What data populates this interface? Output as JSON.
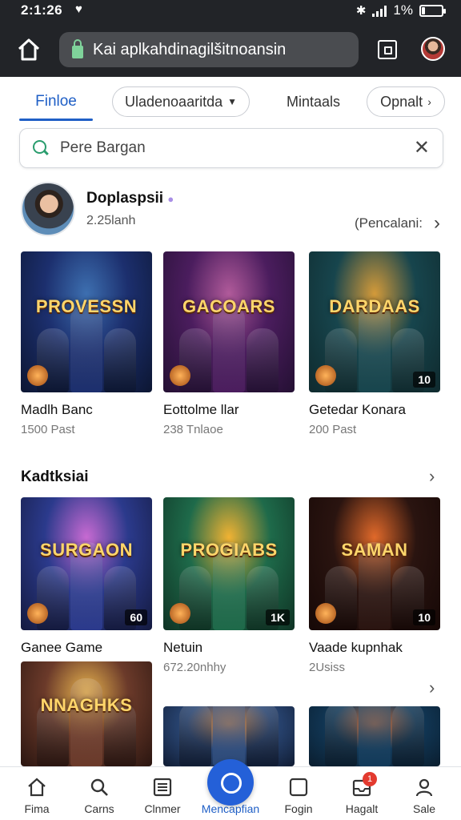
{
  "status": {
    "time": "2:1:26",
    "battery": "1%"
  },
  "browser": {
    "url": "Kai aplkahdinagilšitnoansin"
  },
  "filters": {
    "active_tab": "Finloe",
    "chip1": "Uladenoaaritda",
    "plain": "Mintaals",
    "chip2": "Opnalt"
  },
  "search": {
    "placeholder": "Pere Bargan",
    "value": ""
  },
  "profile": {
    "name": "Doplaspsii",
    "subtitle": "2.25lanh",
    "link": "(Pencalani:"
  },
  "row1": [
    {
      "art": "PROVESSN",
      "title": "Madlh Banc",
      "meta": "1500 Past",
      "badge": "",
      "colors": [
        "#1c2f6e",
        "#3d6fb0",
        "#0c1632"
      ]
    },
    {
      "art": "GACOARS",
      "title": "Eottolme llar",
      "meta": "238 Tnlaoe",
      "badge": "",
      "colors": [
        "#4b1d5e",
        "#b05a9a",
        "#241033"
      ]
    },
    {
      "art": "DARDAAS",
      "title": "Getedar Konara",
      "meta": "200 Past",
      "badge": "10",
      "colors": [
        "#17454d",
        "#d39a3a",
        "#0f2a2e"
      ]
    }
  ],
  "section": {
    "title": "Kadtksiai"
  },
  "row2": [
    {
      "art": "SURGAON",
      "title": "Ganee Game",
      "meta": "",
      "badge": "60",
      "colors": [
        "#2b3a8c",
        "#c76ad2",
        "#141a3f"
      ]
    },
    {
      "art": "PROGIABS",
      "title": "Netuin",
      "meta": "672.20nhhy",
      "badge": "1K",
      "colors": [
        "#1e6a4a",
        "#f0b233",
        "#0f3324"
      ]
    },
    {
      "art": "SAMAN",
      "title": "Vaade kupnhak",
      "meta": "2Usiss",
      "badge": "10",
      "colors": [
        "#2a1410",
        "#e0692a",
        "#160806"
      ]
    }
  ],
  "row3": [
    {
      "art": "NNAGHKS",
      "colors": [
        "#6b3a2a",
        "#e7b34e",
        "#2a1510"
      ]
    },
    {
      "art": "",
      "colors": [
        "#2c4a7a",
        "#e08b3c",
        "#101c33"
      ]
    },
    {
      "art": "",
      "colors": [
        "#123a5a",
        "#d9743c",
        "#0a1d2e"
      ]
    }
  ],
  "nav": [
    {
      "label": "Fima"
    },
    {
      "label": "Carns"
    },
    {
      "label": "Clnmer"
    },
    {
      "label": "Mencapfian"
    },
    {
      "label": "Fogin"
    },
    {
      "label": "Hagalt",
      "badge": "1"
    },
    {
      "label": "Sale"
    }
  ]
}
